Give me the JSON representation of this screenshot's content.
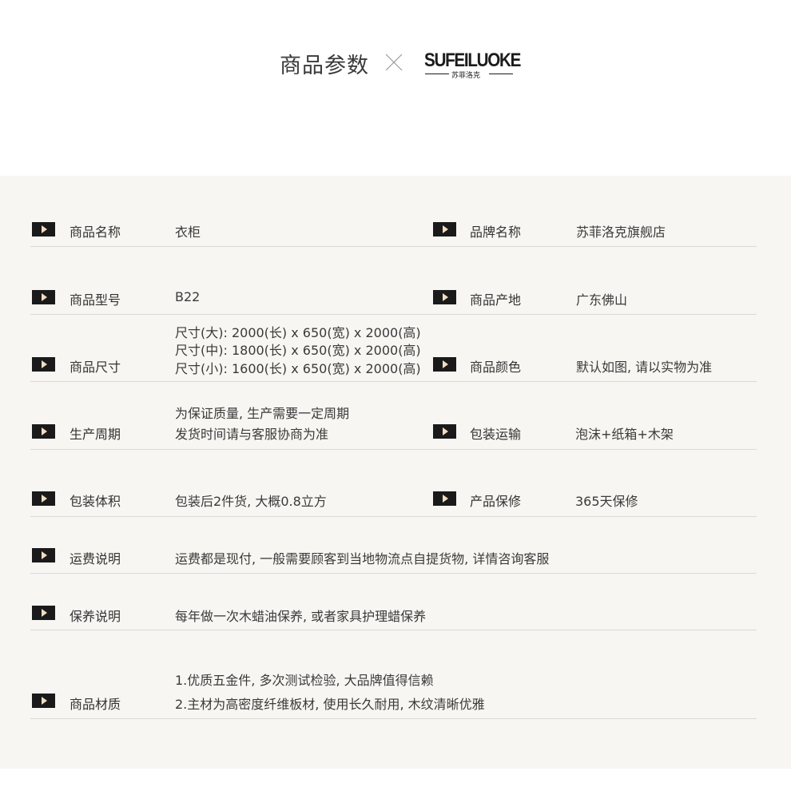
{
  "header": {
    "title": "商品参数",
    "brand_logo": "SUFEILUOKE",
    "brand_logo_sub": "苏菲洛克"
  },
  "colors": {
    "panel_background": "#f7f6f3",
    "marker_background": "#1a1a1a",
    "marker_arrow": "#f2dcc3",
    "divider": "#dcdad5",
    "text": "#333333"
  },
  "specs": {
    "name": {
      "label": "商品名称",
      "value": "衣柜"
    },
    "brand": {
      "label": "品牌名称",
      "value": "苏菲洛克旗舰店"
    },
    "model": {
      "label": "商品型号",
      "value": "B22"
    },
    "origin": {
      "label": "商品产地",
      "value": "广东佛山"
    },
    "size": {
      "label": "商品尺寸",
      "lines": [
        "尺寸(大): 2000(长) x 650(宽) x 2000(高)",
        "尺寸(中): 1800(长) x 650(宽) x 2000(高)",
        "尺寸(小): 1600(长) x 650(宽) x 2000(高)"
      ]
    },
    "color": {
      "label": "商品颜色",
      "value": "默认如图, 请以实物为准"
    },
    "cycle": {
      "label": "生产周期",
      "lines": [
        "为保证质量, 生产需要一定周期",
        "发货时间请与客服协商为准"
      ]
    },
    "packaging": {
      "label": "包装运输",
      "value": "泡沫+纸箱+木架"
    },
    "volume": {
      "label": "包装体积",
      "value": "包装后2件货, 大概0.8立方"
    },
    "warranty": {
      "label": "产品保修",
      "value": "365天保修"
    },
    "shipping": {
      "label": "运费说明",
      "value": "运费都是现付, 一般需要顾客到当地物流点自提货物, 详情咨询客服"
    },
    "care": {
      "label": "保养说明",
      "value": "每年做一次木蜡油保养, 或者家具护理蜡保养"
    },
    "material": {
      "label": "商品材质",
      "lines": [
        "1.优质五金件, 多次测试检验, 大品牌值得信赖",
        "2.主材为高密度纤维板材, 使用长久耐用, 木纹清晰优雅"
      ]
    }
  }
}
